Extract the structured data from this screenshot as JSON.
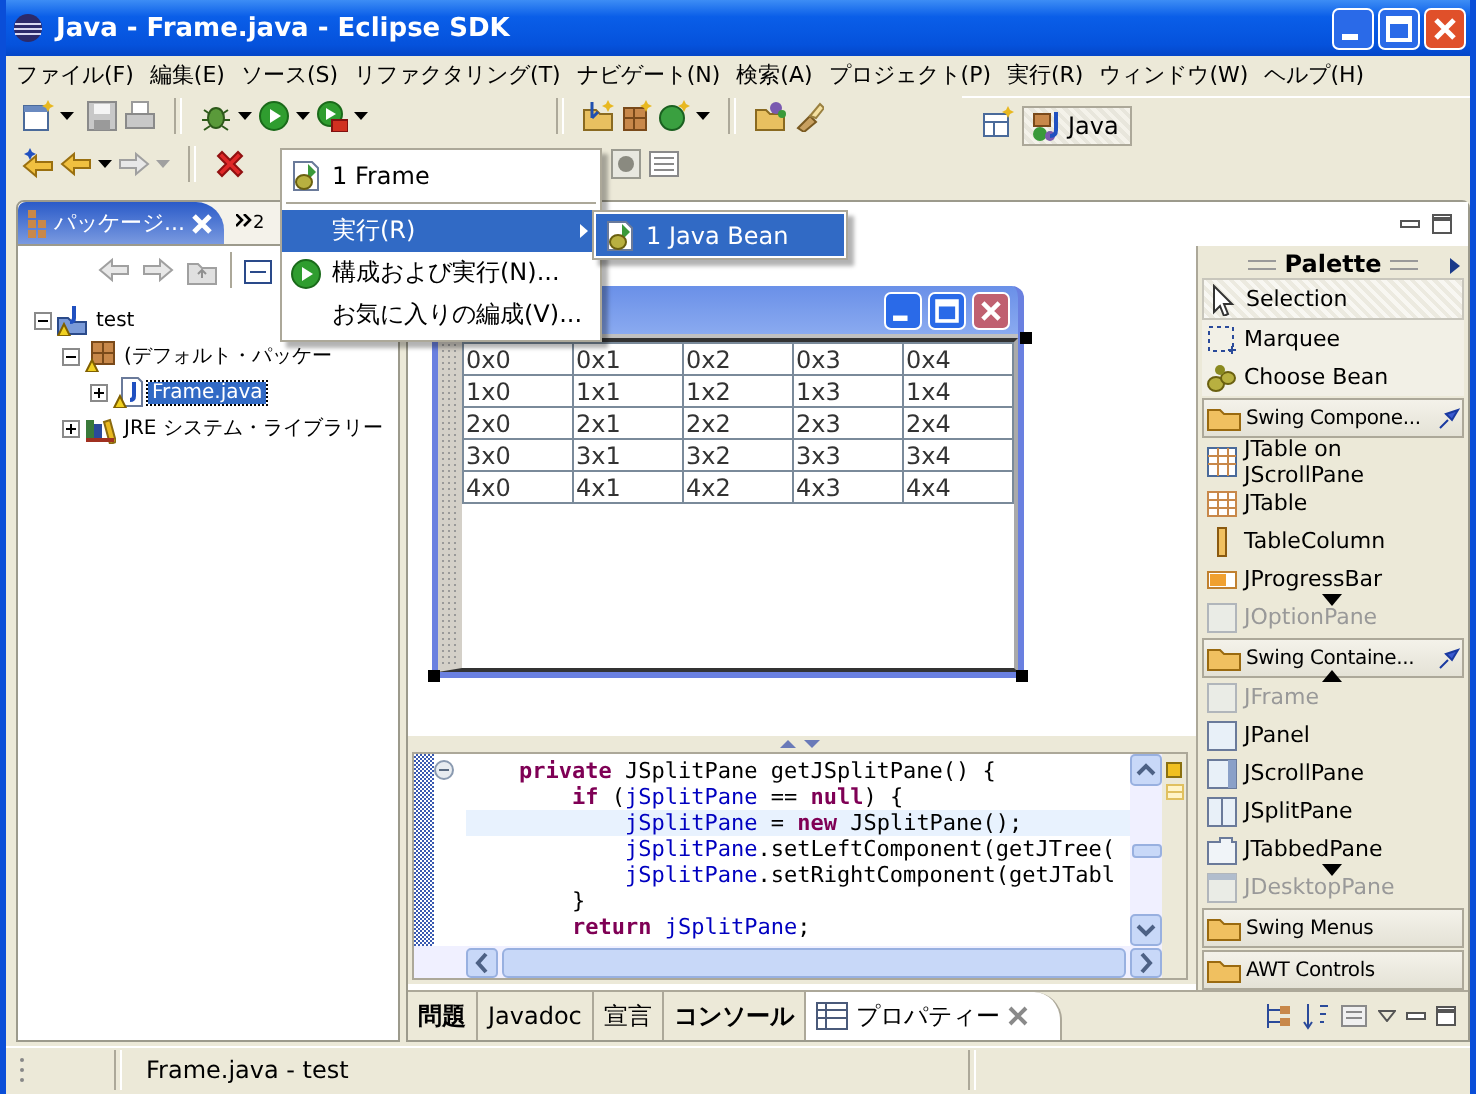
{
  "window": {
    "title": "Java - Frame.java - Eclipse SDK"
  },
  "menu_bar": [
    "ファイル(F)",
    "編集(E)",
    "ソース(S)",
    "リファクタリング(T)",
    "ナビゲート(N)",
    "検索(A)",
    "プロジェクト(P)",
    "実行(R)",
    "ウィンドウ(W)",
    "ヘルプ(H)"
  ],
  "perspective": {
    "label": "Java",
    "selected": true
  },
  "run_menu": {
    "items": [
      {
        "kind": "recent",
        "label": "1 Frame",
        "selected": false
      },
      {
        "kind": "separator"
      },
      {
        "kind": "submenu",
        "label": "実行(R)",
        "selected": true
      },
      {
        "kind": "run",
        "label": "構成および実行(N)...",
        "selected": false
      },
      {
        "kind": "plain",
        "label": "お気に入りの編成(V)...",
        "selected": false
      }
    ],
    "submenu": [
      {
        "label": "1 Java Bean",
        "selected": true
      }
    ]
  },
  "package_explorer": {
    "tab": {
      "label": "パッケージ...",
      "selected": true
    },
    "overflow": "2",
    "tree": [
      {
        "kind": "project",
        "label": "test",
        "expanded": true,
        "selected": false,
        "children": [
          {
            "kind": "package",
            "label": "(デフォルト・パッケー",
            "expanded": true,
            "selected": false,
            "children": [
              {
                "kind": "file",
                "label": "Frame.java",
                "expanded": false,
                "selected": true
              }
            ]
          },
          {
            "kind": "library",
            "label": "JRE システム・ライブラリー",
            "expanded": false,
            "selected": false
          }
        ]
      }
    ]
  },
  "designer": {
    "table": {
      "rows": [
        [
          "0x0",
          "0x1",
          "0x2",
          "0x3",
          "0x4"
        ],
        [
          "1x0",
          "1x1",
          "1x2",
          "1x3",
          "1x4"
        ],
        [
          "2x0",
          "2x1",
          "2x2",
          "2x3",
          "2x4"
        ],
        [
          "3x0",
          "3x1",
          "3x2",
          "3x3",
          "3x4"
        ],
        [
          "4x0",
          "4x1",
          "4x2",
          "4x3",
          "4x4"
        ]
      ]
    }
  },
  "source": {
    "lines": [
      {
        "foldable": true,
        "current": false,
        "tokens": [
          {
            "kind": "keyword",
            "text": "    private"
          },
          {
            "kind": "plain",
            "text": " JSplitPane getJSplitPane() {"
          }
        ]
      },
      {
        "foldable": false,
        "current": false,
        "tokens": [
          {
            "kind": "keyword",
            "text": "        if"
          },
          {
            "kind": "plain",
            "text": " ("
          },
          {
            "kind": "field",
            "text": "jSplitPane"
          },
          {
            "kind": "plain",
            "text": " == "
          },
          {
            "kind": "keyword",
            "text": "null"
          },
          {
            "kind": "plain",
            "text": ") {"
          }
        ]
      },
      {
        "foldable": false,
        "current": true,
        "tokens": [
          {
            "kind": "field",
            "text": "            jSplitPane"
          },
          {
            "kind": "plain",
            "text": " = "
          },
          {
            "kind": "keyword",
            "text": "new"
          },
          {
            "kind": "plain",
            "text": " JSplitPane();"
          }
        ]
      },
      {
        "foldable": false,
        "current": false,
        "tokens": [
          {
            "kind": "field",
            "text": "            jSplitPane"
          },
          {
            "kind": "plain",
            "text": ".setLeftComponent(getJTree("
          }
        ]
      },
      {
        "foldable": false,
        "current": false,
        "tokens": [
          {
            "kind": "field",
            "text": "            jSplitPane"
          },
          {
            "kind": "plain",
            "text": ".setRightComponent(getJTabl"
          }
        ]
      },
      {
        "foldable": false,
        "current": false,
        "tokens": [
          {
            "kind": "plain",
            "text": "        }"
          }
        ]
      },
      {
        "foldable": false,
        "current": false,
        "tokens": [
          {
            "kind": "keyword",
            "text": "        return"
          },
          {
            "kind": "field",
            "text": " jSplitPane"
          },
          {
            "kind": "plain",
            "text": ";"
          }
        ]
      }
    ]
  },
  "palette": {
    "title": "Palette",
    "entries": [
      {
        "kind": "tool",
        "label": "Selection",
        "selected": true
      },
      {
        "kind": "tool",
        "label": "Marquee",
        "selected": false
      },
      {
        "kind": "tool",
        "label": "Choose Bean",
        "selected": false
      },
      {
        "kind": "drawer",
        "label": "Swing Compone...",
        "pinned": true
      },
      {
        "kind": "item",
        "label": "JTable on JScrollPane",
        "faded": false
      },
      {
        "kind": "item",
        "label": "JTable",
        "faded": false
      },
      {
        "kind": "item",
        "label": "TableColumn",
        "faded": false
      },
      {
        "kind": "item",
        "label": "JProgressBar",
        "faded": false
      },
      {
        "kind": "item",
        "label": "JOptionPane",
        "faded": true
      },
      {
        "kind": "drawer",
        "label": "Swing Containe...",
        "pinned": true
      },
      {
        "kind": "item",
        "label": "JFrame",
        "faded": true
      },
      {
        "kind": "item",
        "label": "JPanel",
        "faded": false
      },
      {
        "kind": "item",
        "label": "JScrollPane",
        "faded": false
      },
      {
        "kind": "item",
        "label": "JSplitPane",
        "faded": false
      },
      {
        "kind": "item",
        "label": "JTabbedPane",
        "faded": false
      },
      {
        "kind": "item",
        "label": "JDesktopPane",
        "faded": true
      },
      {
        "kind": "drawer",
        "label": "Swing Menus",
        "pinned": false
      },
      {
        "kind": "drawer",
        "label": "AWT Controls",
        "pinned": false
      }
    ]
  },
  "bottom_tabs": [
    {
      "label": "問題",
      "bold": true,
      "selected": false
    },
    {
      "label": "Javadoc",
      "bold": false,
      "selected": false
    },
    {
      "label": "宣言",
      "bold": false,
      "selected": false
    },
    {
      "label": "コンソール",
      "bold": true,
      "selected": false
    },
    {
      "label": "プロパティー",
      "bold": false,
      "selected": true
    }
  ],
  "status_bar": {
    "text": "Frame.java - test"
  }
}
